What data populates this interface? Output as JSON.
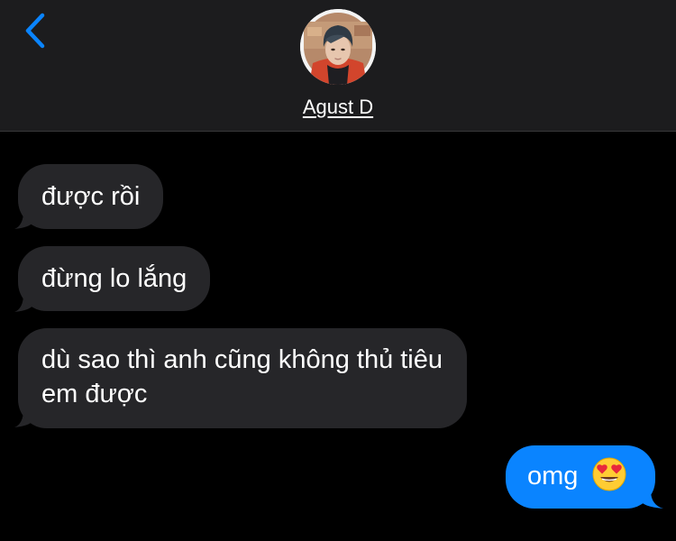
{
  "header": {
    "contact_name": "Agust D",
    "back_icon": "chevron-left-icon",
    "accent_color": "#0a84ff"
  },
  "messages": [
    {
      "direction": "incoming",
      "text": "được rồi"
    },
    {
      "direction": "incoming",
      "text": "đừng lo lắng"
    },
    {
      "direction": "incoming",
      "text": "dù sao thì anh cũng không thủ tiêu em được"
    },
    {
      "direction": "outgoing",
      "text": "omg",
      "emoji": "heart-eyes-emoji"
    }
  ],
  "colors": {
    "incoming_bubble": "#262629",
    "outgoing_bubble": "#0a84ff",
    "background": "#000000",
    "header_background": "#1c1c1e"
  }
}
